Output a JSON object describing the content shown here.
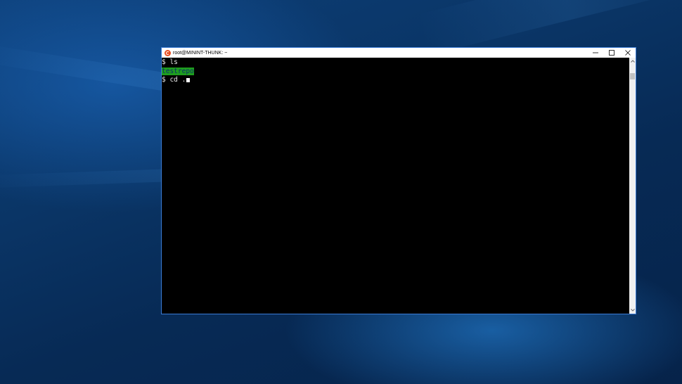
{
  "window": {
    "title": "root@MININT-THUNK: ~",
    "icon": "ubuntu-icon",
    "controls": [
      "minimize-icon",
      "maximize-icon",
      "close-icon"
    ]
  },
  "terminal": {
    "lines": [
      {
        "prompt": "$ ",
        "command": "ls"
      },
      {
        "output": "testrepo"
      },
      {
        "prompt": "$ ",
        "command": "cd ."
      }
    ]
  },
  "colors": {
    "terminal_bg": "#000000",
    "terminal_fg": "#e8e8e8",
    "directory_highlight": "#1e9e1e",
    "titlebar_bg": "#ffffff",
    "window_border": "#3a7bd5"
  }
}
